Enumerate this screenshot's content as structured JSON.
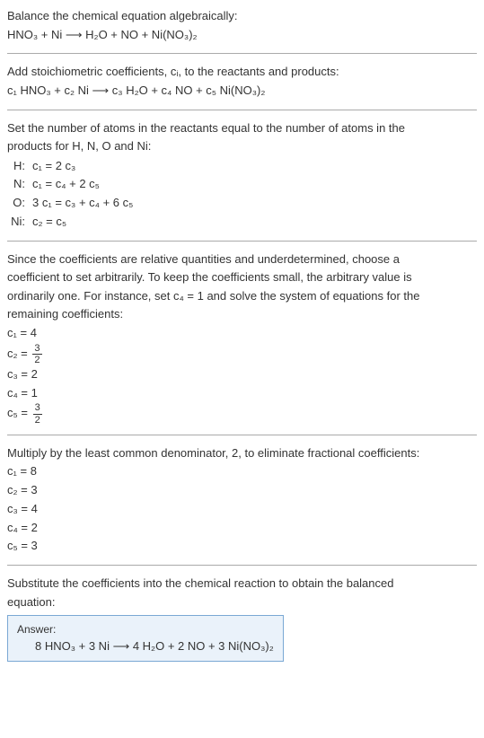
{
  "intro": {
    "line1": "Balance the chemical equation algebraically:",
    "eq": "HNO₃ + Ni ⟶ H₂O + NO + Ni(NO₃)₂"
  },
  "step1": {
    "text": "Add stoichiometric coefficients, cᵢ, to the reactants and products:",
    "eq": "c₁ HNO₃ + c₂ Ni ⟶ c₃ H₂O + c₄ NO + c₅ Ni(NO₃)₂"
  },
  "step2": {
    "text1": "Set the number of atoms in the reactants equal to the number of atoms in the",
    "text2": "products for H, N, O and Ni:",
    "rows": [
      {
        "label": "H:",
        "eq": "c₁ = 2 c₃"
      },
      {
        "label": "N:",
        "eq": "c₁ = c₄ + 2 c₅"
      },
      {
        "label": "O:",
        "eq": "3 c₁ = c₃ + c₄ + 6 c₅"
      },
      {
        "label": "Ni:",
        "eq": "c₂ = c₅"
      }
    ]
  },
  "step3": {
    "text1": "Since the coefficients are relative quantities and underdetermined, choose a",
    "text2": "coefficient to set arbitrarily. To keep the coefficients small, the arbitrary value is",
    "text3": "ordinarily one. For instance, set c₄ = 1 and solve the system of equations for the",
    "text4": "remaining coefficients:",
    "coeffs": {
      "c1": "c₁ = 4",
      "c2_prefix": "c₂ = ",
      "c2_num": "3",
      "c2_den": "2",
      "c3": "c₃ = 2",
      "c4": "c₄ = 1",
      "c5_prefix": "c₅ = ",
      "c5_num": "3",
      "c5_den": "2"
    }
  },
  "step4": {
    "text": "Multiply by the least common denominator, 2, to eliminate fractional coefficients:",
    "coeffs": [
      "c₁ = 8",
      "c₂ = 3",
      "c₃ = 4",
      "c₄ = 2",
      "c₅ = 3"
    ]
  },
  "step5": {
    "text1": "Substitute the coefficients into the chemical reaction to obtain the balanced",
    "text2": "equation:"
  },
  "answer": {
    "label": "Answer:",
    "eq": "8 HNO₃ + 3 Ni ⟶ 4 H₂O + 2 NO + 3 Ni(NO₃)₂"
  }
}
